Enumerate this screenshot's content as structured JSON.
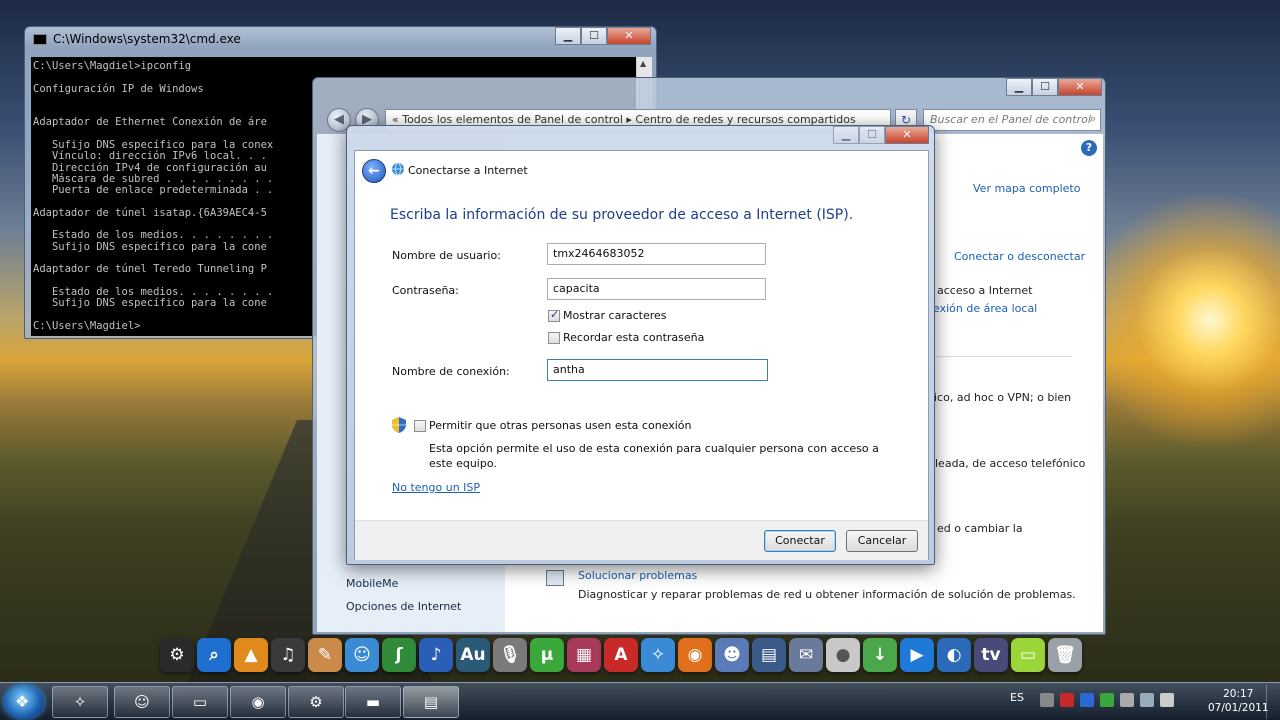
{
  "cmd": {
    "title": "C:\\Windows\\system32\\cmd.exe",
    "lines": [
      "C:\\Users\\Magdiel>ipconfig",
      "",
      "Configuración IP de Windows",
      "",
      "",
      "Adaptador de Ethernet Conexión de áre",
      "",
      "   Sufijo DNS específico para la conex",
      "   Vínculo: dirección IPv6 local. . .",
      "   Dirección IPv4 de configuración au",
      "   Máscara de subred . . . . . . . . .",
      "   Puerta de enlace predeterminada . .",
      "",
      "Adaptador de túnel isatap.{6A39AEC4-5",
      "",
      "   Estado de los medios. . . . . . . .",
      "   Sufijo DNS específico para la cone",
      "",
      "Adaptador de túnel Teredo Tunneling P",
      "",
      "   Estado de los medios. . . . . . . .",
      "   Sufijo DNS específico para la cone",
      "",
      "C:\\Users\\Magdiel>"
    ]
  },
  "control_panel": {
    "address": "«  Todos los elementos de Panel de control  ▸  Centro de redes y recursos compartidos",
    "search_placeholder": "Buscar en el Panel de control",
    "links": {
      "ver_mapa": "Ver mapa completo",
      "conectar_desconectar": "Conectar o desconectar",
      "acceso_internet": "acceso a Internet",
      "conexion_area_local": "exión de área local",
      "solucionar": "Solucionar problemas"
    },
    "texts": {
      "adhoc": "ico, ad hoc o VPN; o bien",
      "acceso_tel": "leada, de acceso telefónico",
      "cambiar": "ed o cambiar la",
      "diagnosticar": "Diagnosticar y reparar problemas de red u obtener información de solución de problemas."
    },
    "left_items": [
      "MobileMe",
      "Opciones de Internet"
    ]
  },
  "wizard": {
    "title": "Conectarse a Internet",
    "heading": "Escriba la información de su proveedor de acceso a Internet (ISP).",
    "username_label": "Nombre de usuario:",
    "username_value": "tmx2464683052",
    "password_label": "Contraseña:",
    "password_value": "capacita",
    "show_chars_label": "Mostrar caracteres",
    "show_chars_checked": true,
    "remember_label": "Recordar esta contraseña",
    "remember_checked": false,
    "connection_name_label": "Nombre de conexión:",
    "connection_name_value": "antha",
    "allow_others_label": "Permitir que otras personas usen esta conexión",
    "allow_others_checked": false,
    "allow_others_desc_1": "Esta opción permite el uso de esta conexión para cualquier persona con acceso a",
    "allow_others_desc_2": "este equipo.",
    "no_isp_link": "No tengo un ISP",
    "connect_button": "Conectar",
    "cancel_button": "Cancelar"
  },
  "taskbar": {
    "language": "ES",
    "time": "20:17",
    "date": "07/01/2011"
  },
  "dock_icons": [
    "network-icon",
    "search-icon",
    "vlc-icon",
    "itunes-icon",
    "paint-icon",
    "messenger-icon",
    "dreamweaver-icon",
    "quicktime-icon",
    "audition-icon",
    "microphone-icon",
    "utorrent-icon",
    "winrar-icon",
    "autocad-icon",
    "safari-icon",
    "firefox-icon",
    "finder-icon",
    "apps-icon",
    "photos-icon",
    "apple-icon",
    "download-icon",
    "play-icon",
    "earth-icon",
    "tv-icon",
    "notes-icon",
    "trash-icon"
  ]
}
